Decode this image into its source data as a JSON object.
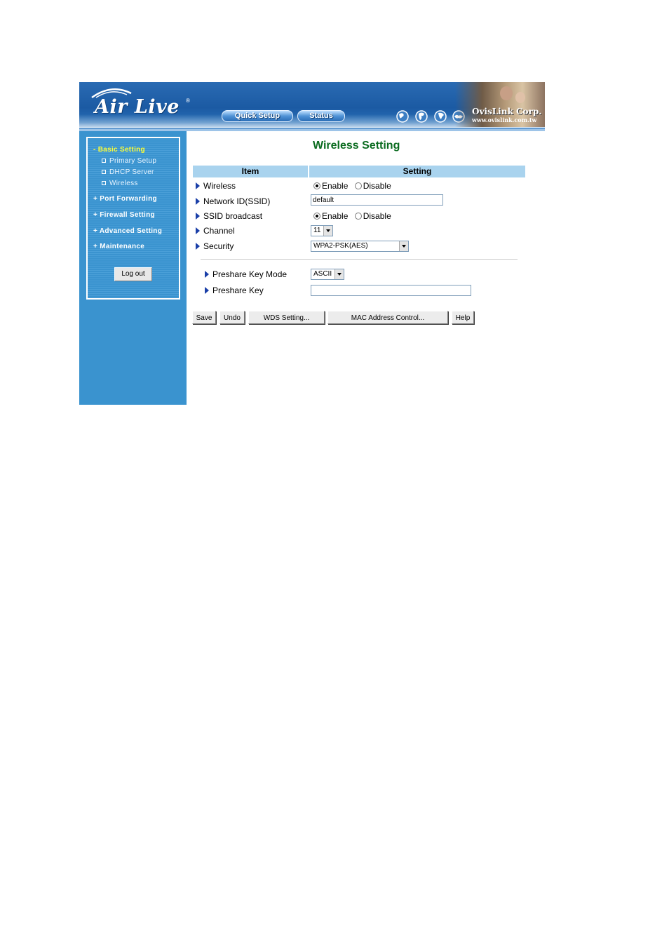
{
  "header": {
    "logo_text": "Air Live",
    "logo_mark": "®",
    "nav_buttons": [
      "Quick Setup",
      "Status"
    ],
    "corp_name": "OvisLink Corp.",
    "corp_url": "www.ovislink.com.tw",
    "globe_icon_count": 4
  },
  "sidebar": {
    "items": [
      {
        "label": "- Basic Setting",
        "type": "active"
      },
      {
        "label": "Primary Setup",
        "type": "sub"
      },
      {
        "label": "DHCP Server",
        "type": "sub"
      },
      {
        "label": "Wireless",
        "type": "sub"
      },
      {
        "label": "+ Port Forwarding",
        "type": "head"
      },
      {
        "label": "+ Firewall Setting",
        "type": "head"
      },
      {
        "label": "+ Advanced Setting",
        "type": "head"
      },
      {
        "label": "+ Maintenance",
        "type": "head"
      }
    ],
    "logout_label": "Log out"
  },
  "main": {
    "title": "Wireless Setting",
    "table_headers": {
      "item": "Item",
      "setting": "Setting"
    },
    "rows": {
      "wireless": {
        "label": "Wireless",
        "options": [
          "Enable",
          "Disable"
        ],
        "selected": "Enable"
      },
      "ssid": {
        "label": "Network ID(SSID)",
        "value": "default"
      },
      "ssid_broadcast": {
        "label": "SSID broadcast",
        "options": [
          "Enable",
          "Disable"
        ],
        "selected": "Enable"
      },
      "channel": {
        "label": "Channel",
        "value": "11"
      },
      "security": {
        "label": "Security",
        "value": "WPA2-PSK(AES)"
      },
      "psk_mode": {
        "label": "Preshare Key Mode",
        "value": "ASCII"
      },
      "psk": {
        "label": "Preshare Key",
        "value": ""
      }
    },
    "buttons": {
      "save": "Save",
      "undo": "Undo",
      "wds": "WDS Setting...",
      "mac": "MAC Address Control...",
      "help": "Help"
    }
  },
  "colors": {
    "header_blue": "#1b5aa3",
    "sidebar_blue": "#3a93cf",
    "table_header": "#a9d3ee",
    "title_green": "#0a6b1f",
    "active_menu": "#ffff33"
  }
}
